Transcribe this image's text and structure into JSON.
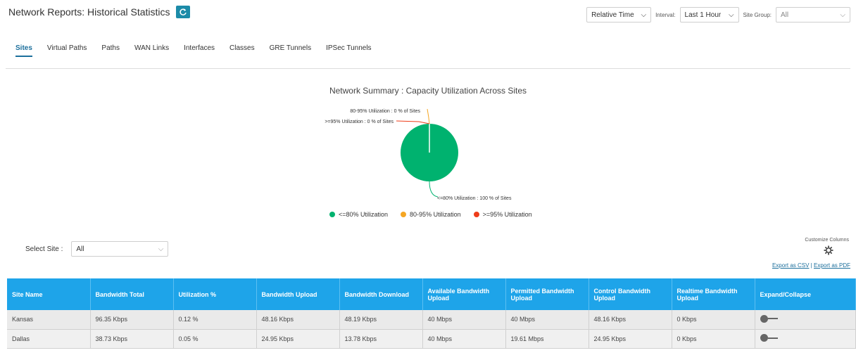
{
  "header": {
    "title": "Network Reports: Historical Statistics"
  },
  "controls": {
    "time_mode": "Relative Time",
    "interval_label": "Interval:",
    "interval_value": "Last 1 Hour",
    "site_group_label": "Site Group:",
    "site_group_value": "All"
  },
  "tabs": [
    {
      "label": "Sites"
    },
    {
      "label": "Virtual Paths"
    },
    {
      "label": "Paths"
    },
    {
      "label": "WAN Links"
    },
    {
      "label": "Interfaces"
    },
    {
      "label": "Classes"
    },
    {
      "label": "GRE Tunnels"
    },
    {
      "label": "IPSec Tunnels"
    }
  ],
  "chart_data": {
    "type": "pie",
    "title": "Network Summary : Capacity Utilization Across Sites",
    "slices": [
      {
        "name": "<=80% Utilization",
        "value": 100,
        "color": "#00b26f",
        "label": "<=80% Utilization : 100 % of Sites"
      },
      {
        "name": "80-95% Utilization",
        "value": 0,
        "color": "#f5a623",
        "label": "80-95% Utilization : 0 % of Sites"
      },
      {
        "name": ">=95% Utilization",
        "value": 0,
        "color": "#ee3d1a",
        "label": ">=95% Utilization : 0 % of Sites"
      }
    ]
  },
  "site_filter": {
    "label": "Select Site :",
    "value": "All"
  },
  "customize": {
    "label": "Customize Columns",
    "export_csv": "Export as CSV",
    "separator": "|",
    "export_pdf": "Export as PDF"
  },
  "table": {
    "headers": [
      "Site Name",
      "Bandwidth Total",
      "Utilization %",
      "Bandwidth Upload",
      "Bandwidth Download",
      "Available Bandwidth Upload",
      "Permitted Bandwidth Upload",
      "Control Bandwidth Upload",
      "Realtime Bandwidth Upload",
      "Expand/Collapse"
    ],
    "rows": [
      [
        "Kansas",
        "96.35 Kbps",
        "0.12 %",
        "48.16 Kbps",
        "48.19 Kbps",
        "40 Mbps",
        "40 Mbps",
        "48.16 Kbps",
        "0 Kbps"
      ],
      [
        "Dallas",
        "38.73 Kbps",
        "0.05 %",
        "24.95 Kbps",
        "13.78 Kbps",
        "40 Mbps",
        "19.61 Mbps",
        "24.95 Kbps",
        "0 Kbps"
      ]
    ]
  }
}
